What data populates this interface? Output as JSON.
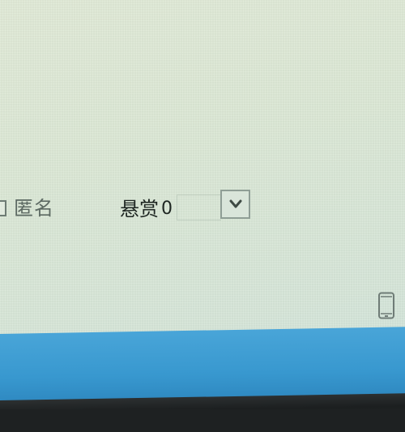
{
  "form": {
    "anonymous_label": "匿名",
    "anonymous_checked": false,
    "reward_label": "悬赏",
    "reward_value": "0"
  },
  "icons": {
    "dropdown": "chevron-down-icon",
    "mobile": "mobile-phone-icon",
    "checkbox": "checkbox-unchecked"
  },
  "colors": {
    "page_background": "#dbe8d5",
    "taskbar": "#3b9ad1",
    "bezel": "#1e2122"
  }
}
